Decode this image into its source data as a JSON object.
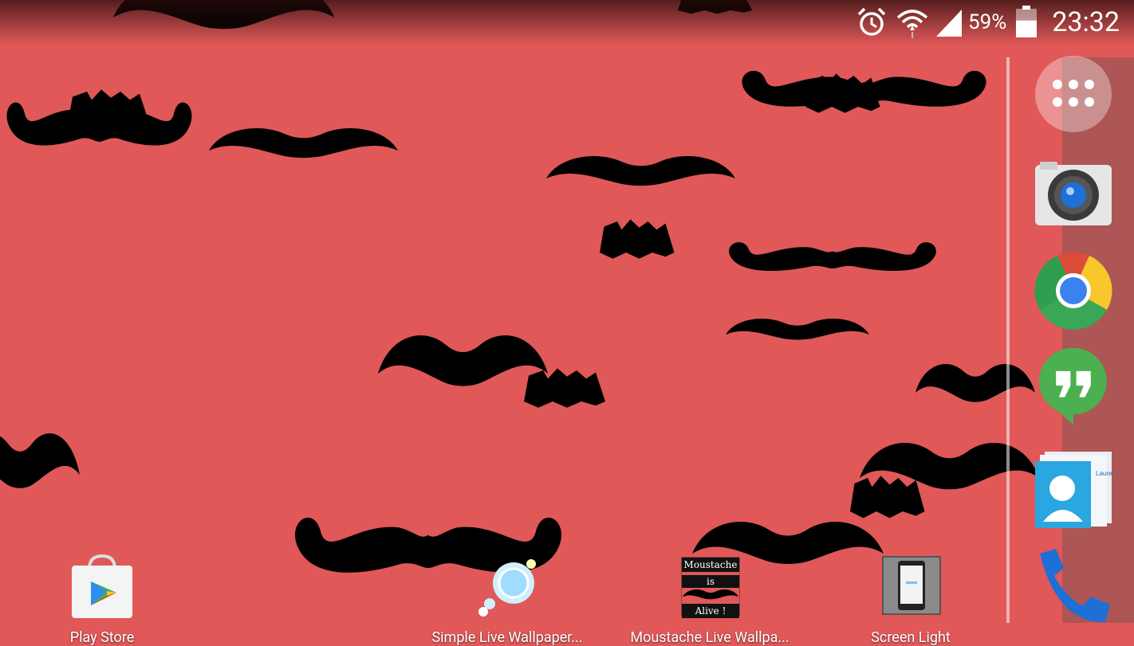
{
  "status_bar": {
    "battery_percent": "59%",
    "battery_level": 0.59,
    "time": "23:32",
    "icons": [
      "alarm-icon",
      "wifi-icon",
      "signal-icon",
      "battery-icon"
    ]
  },
  "dock": {
    "items": [
      "apps-drawer-icon",
      "camera-icon",
      "chrome-icon",
      "hangouts-icon",
      "contacts-icon",
      "phone-icon"
    ]
  },
  "home_apps": [
    {
      "label": "Play Store",
      "icon": "play-store-icon"
    },
    {
      "label": "Simple Live Wallpaper...",
      "icon": "simple-live-wallpaper-icon"
    },
    {
      "label": "Moustache Live Wallpa...",
      "icon": "moustache-wallpaper-icon"
    },
    {
      "label": "Screen Light",
      "icon": "screen-light-icon"
    }
  ],
  "moustache_icon_text": {
    "line1": "Moustache",
    "line2": "is",
    "line3": "Alive !"
  },
  "colors": {
    "wallpaper": "#e05858",
    "moustache": "#000000",
    "hangouts": "#4caf50"
  }
}
